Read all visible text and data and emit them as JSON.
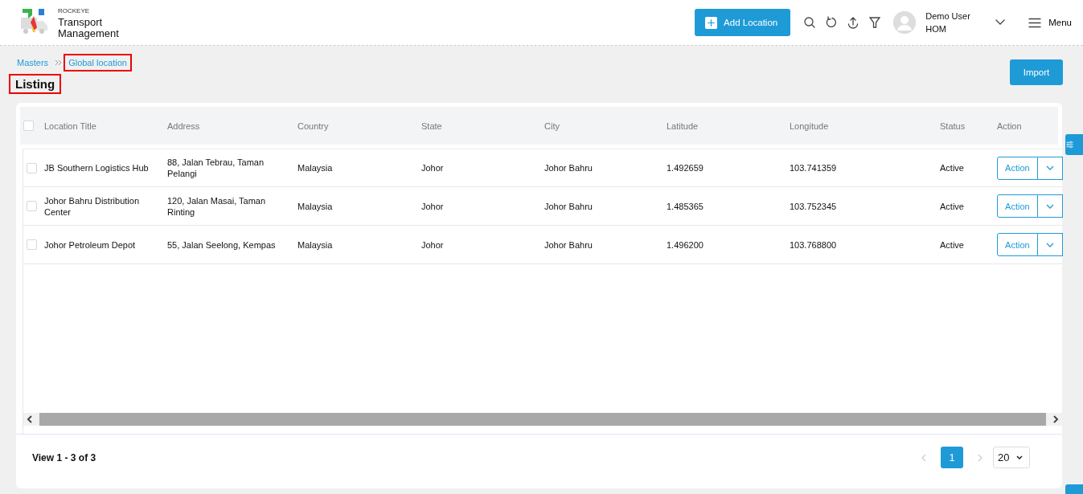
{
  "header": {
    "logo": {
      "brand": "ROCKEYE",
      "title_line_1": "Transport",
      "title_line_2": "Management"
    },
    "add_button": "Add Location",
    "user": {
      "name": "Demo User",
      "role": "HOM"
    },
    "menu": "Menu"
  },
  "breadcrumb": [
    {
      "label": "Masters",
      "highlighted": false
    },
    {
      "label": "Global location",
      "highlighted": true
    }
  ],
  "page_title": {
    "text": "Listing",
    "highlighted": true
  },
  "import_button": "Import",
  "table": {
    "select_all_checked": false,
    "columns": [
      "Location Title",
      "Address",
      "Country",
      "State",
      "City",
      "Latitude",
      "Longitude",
      "Status",
      "Action"
    ],
    "rows": [
      {
        "checked": false,
        "cells": [
          "JB Southern Logistics Hub",
          "88, Jalan Tebrau, Taman Pelangi",
          "Malaysia",
          "Johor",
          "Johor Bahru",
          "1.492659",
          "103.741359",
          "Active"
        ],
        "action": "Action"
      },
      {
        "checked": false,
        "cells": [
          "Johor Bahru Distribution Center",
          "120, Jalan Masai, Taman Rinting",
          "Malaysia",
          "Johor",
          "Johor Bahru",
          "1.485365",
          "103.752345",
          "Active"
        ],
        "action": "Action"
      },
      {
        "checked": false,
        "cells": [
          "Johor Petroleum Depot",
          "55, Jalan Seelong, Kempas",
          "Malaysia",
          "Johor",
          "Johor Bahru",
          "1.496200",
          "103.768800",
          "Active"
        ],
        "action": "Action"
      }
    ]
  },
  "footer": {
    "summary": "View 1 - 3 of 3",
    "pages": [
      {
        "label": "1",
        "selected": true
      }
    ],
    "page_size": "20"
  }
}
